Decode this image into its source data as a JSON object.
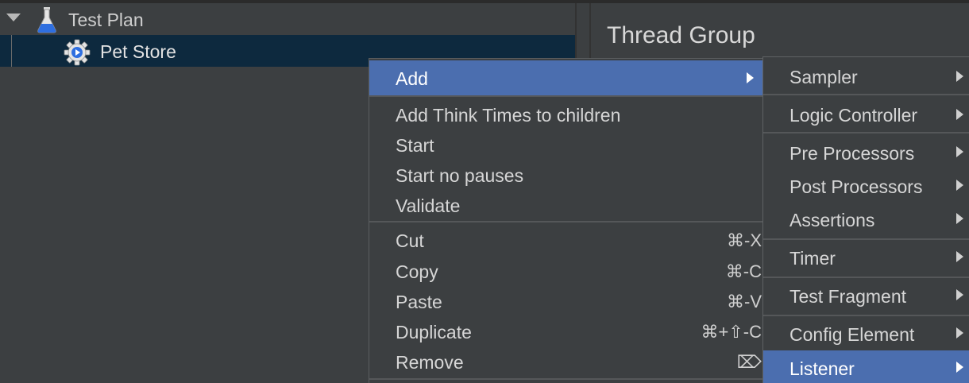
{
  "tree": {
    "items": [
      {
        "label": "Test Plan",
        "icon": "flask-icon",
        "expanded": true
      },
      {
        "label": "Pet Store",
        "icon": "gear-icon",
        "selected": true
      }
    ]
  },
  "panel": {
    "title": "Thread Group"
  },
  "context_menu": {
    "items": [
      {
        "label": "Add",
        "shortcut": "",
        "submenu": true,
        "highlighted": true
      },
      {
        "label": "Add Think Times to children",
        "shortcut": ""
      },
      {
        "label": "Start",
        "shortcut": ""
      },
      {
        "label": "Start no pauses",
        "shortcut": ""
      },
      {
        "label": "Validate",
        "shortcut": ""
      },
      {
        "label": "Cut",
        "shortcut": "⌘-X"
      },
      {
        "label": "Copy",
        "shortcut": "⌘-C"
      },
      {
        "label": "Paste",
        "shortcut": "⌘-V"
      },
      {
        "label": "Duplicate",
        "shortcut": "⌘+⇧-C"
      },
      {
        "label": "Remove",
        "shortcut": "⌦"
      }
    ]
  },
  "add_submenu": {
    "items": [
      {
        "label": "Sampler"
      },
      {
        "label": "Logic Controller"
      },
      {
        "label": "Pre Processors"
      },
      {
        "label": "Post Processors"
      },
      {
        "label": "Assertions"
      },
      {
        "label": "Timer"
      },
      {
        "label": "Test Fragment"
      },
      {
        "label": "Config Element"
      },
      {
        "label": "Listener",
        "highlighted": true
      }
    ]
  },
  "colors": {
    "background": "#3c3f41",
    "selection": "#4b6eaf",
    "tree_selection": "#0d293e",
    "text": "#d6d6d6"
  }
}
